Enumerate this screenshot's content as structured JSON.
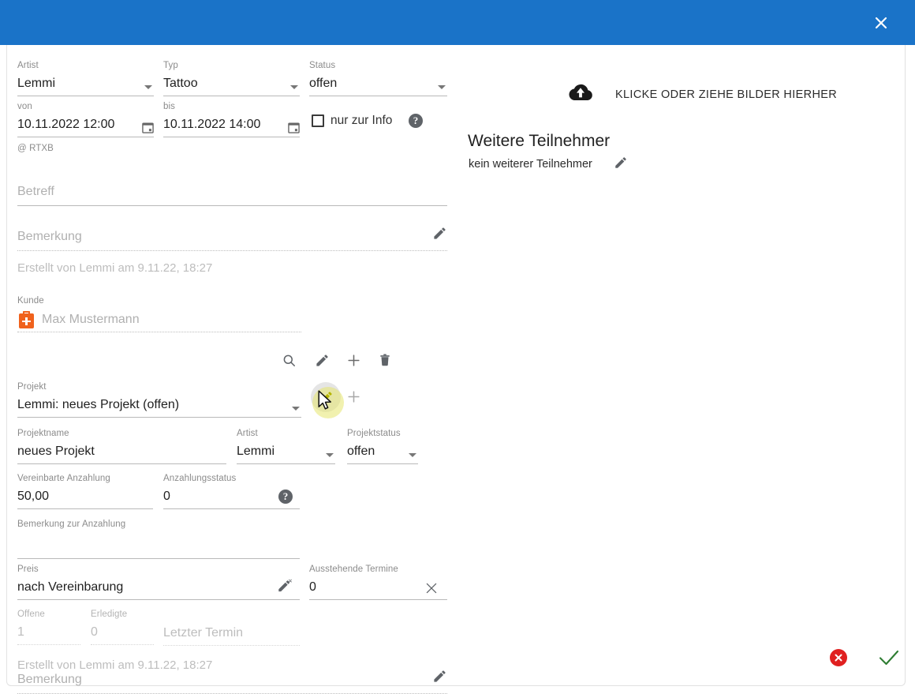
{
  "titlebar": {
    "close_icon": "close-icon"
  },
  "appointment": {
    "artist": {
      "label": "Artist",
      "value": "Lemmi"
    },
    "typ": {
      "label": "Typ",
      "value": "Tattoo"
    },
    "status": {
      "label": "Status",
      "value": "offen"
    },
    "von": {
      "label": "von",
      "value": "10.11.2022 12:00"
    },
    "bis": {
      "label": "bis",
      "value": "10.11.2022 14:00"
    },
    "info_only": {
      "label": "nur zur Info",
      "checked": false,
      "help": "?"
    },
    "location": "@ RTXB",
    "betreff": {
      "label": "Betreff",
      "value": ""
    },
    "bemerkung": {
      "label": "Bemerkung",
      "value": ""
    },
    "created": "Erstellt von Lemmi am 9.11.22, 18:27"
  },
  "kunde": {
    "label": "Kunde",
    "value": "Max Mustermann",
    "icons": [
      "search-icon",
      "edit-icon",
      "add-icon",
      "delete-icon"
    ]
  },
  "projekt": {
    "label": "Projekt",
    "value": "Lemmi: neues Projekt (offen)",
    "icons": [
      "edit-icon",
      "add-icon"
    ]
  },
  "projekt_detail": {
    "projektname": {
      "label": "Projektname",
      "value": "neues Projekt"
    },
    "artist": {
      "label": "Artist",
      "value": "Lemmi"
    },
    "projektstatus": {
      "label": "Projektstatus",
      "value": "offen"
    },
    "vereinbarte_anzahlung": {
      "label": "Vereinbarte Anzahlung",
      "value": "50,00"
    },
    "anzahlungsstatus": {
      "label": "Anzahlungsstatus",
      "value": "0",
      "help": "?"
    },
    "bemerkung_anzahlung": {
      "label": "Bemerkung zur Anzahlung",
      "value": ""
    },
    "preis": {
      "label": "Preis",
      "value": "nach Vereinbarung"
    },
    "ausstehende_termine": {
      "label": "Ausstehende Termine",
      "value": "0"
    },
    "offene": {
      "label": "Offene",
      "value": "1"
    },
    "erledigte": {
      "label": "Erledigte",
      "value": "0"
    },
    "letzter_termin": {
      "label": "Letzter Termin",
      "value": ""
    },
    "bemerkung": {
      "label": "Bemerkung",
      "value": ""
    },
    "created": "Erstellt von Lemmi am 9.11.22, 18:27"
  },
  "right": {
    "dropzone_text": "KLICKE ODER ZIEHE BILDER HIERHER",
    "dropzone_icon": "cloud-upload-icon",
    "participants_title": "Weitere Teilnehmer",
    "participants_value": "kein weiterer Teilnehmer",
    "participants_edit_icon": "edit-icon"
  },
  "actions": {
    "cancel_icon": "cancel-circle-icon",
    "confirm_icon": "check-icon"
  },
  "colors": {
    "titlebar": "#1a73c8",
    "accent_orange": "#f0621d",
    "cancel_red": "#e02020",
    "confirm_green": "#2e7d32",
    "hover_yellow": "#e6e66e"
  }
}
